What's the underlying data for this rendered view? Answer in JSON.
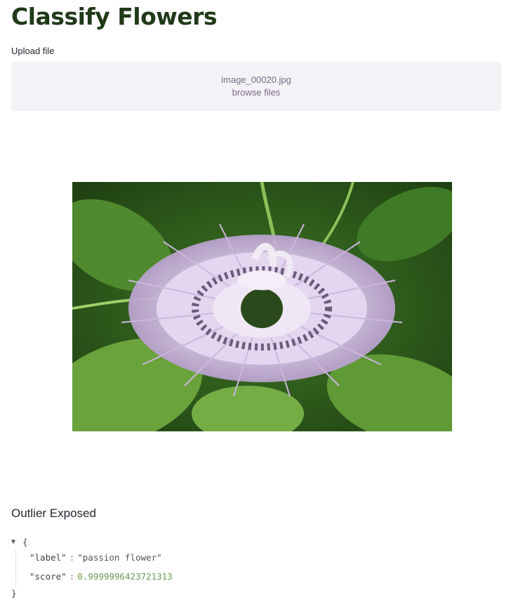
{
  "page": {
    "title": "Classify Flowers"
  },
  "uploader": {
    "label": "Upload file",
    "filename": "image_00020.jpg",
    "browse_text": "browse files"
  },
  "result": {
    "heading": "Outlier Exposed",
    "open_brace": "{",
    "close_brace": "}",
    "entries": [
      {
        "key": "\"label\"",
        "value": "\"passion flower\"",
        "type": "string"
      },
      {
        "key": "\"score\"",
        "value": "0.9999996423721313",
        "type": "number"
      }
    ]
  },
  "colors": {
    "title": "#1f3a18",
    "dropzone_bg": "#f3f2f7",
    "number_value": "#6a9955"
  },
  "icons": {
    "json_toggle": "caret-down-icon"
  }
}
